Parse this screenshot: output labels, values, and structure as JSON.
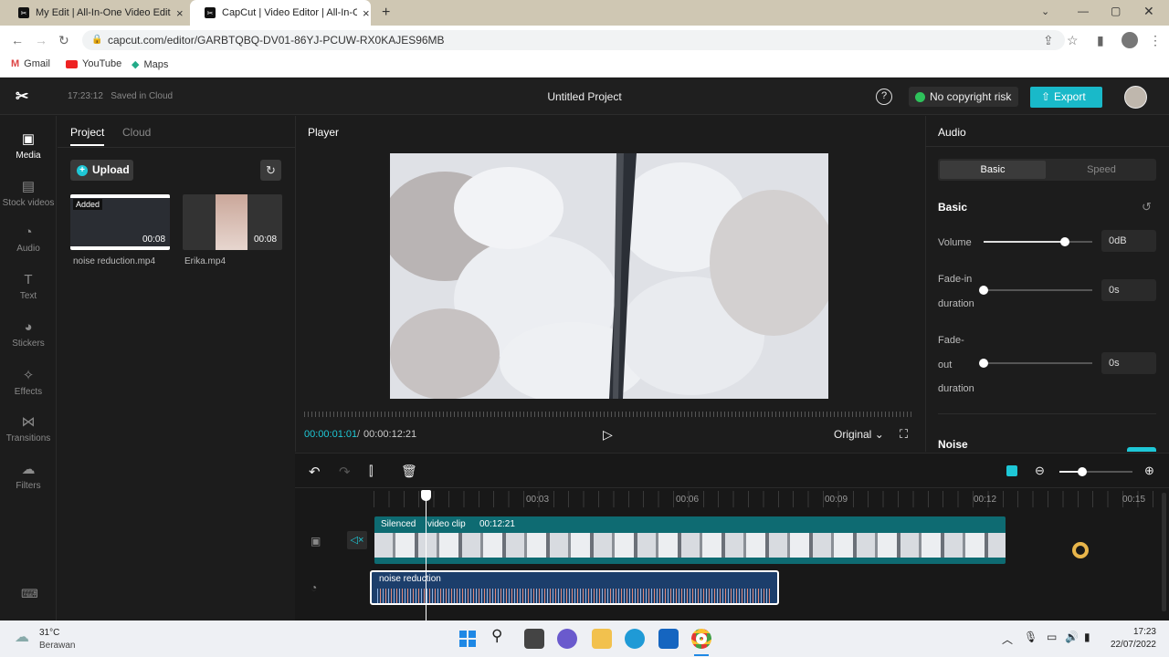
{
  "browser": {
    "tabs": [
      {
        "title": "My Edit | All-In-One Video Editing",
        "close": "×"
      },
      {
        "title": "CapCut | Video Editor | All-In-One",
        "close": "×"
      }
    ],
    "new_tab": "+",
    "url": "capcut.com/editor/GARBTQBQ-DV01-86YJ-PCUW-RX0KAJES96MB",
    "bookmarks": [
      "Gmail",
      "YouTube",
      "Maps"
    ]
  },
  "header": {
    "saved_status": "17:23:12   Saved in Cloud",
    "project_title": "Untitled Project",
    "help": "?",
    "copyright": "No copyright risk",
    "export": "Export"
  },
  "rail": [
    "Media",
    "Stock videos",
    "Audio",
    "Text",
    "Stickers",
    "Effects",
    "Transitions",
    "Filters"
  ],
  "media": {
    "tabs": [
      "Project",
      "Cloud"
    ],
    "upload": "Upload",
    "items": [
      {
        "name": "noise reduction.mp4",
        "duration": "00:08",
        "badge": "Added"
      },
      {
        "name": "Erika.mp4",
        "duration": "00:08"
      }
    ]
  },
  "player": {
    "title": "Player",
    "current_time": "00:00:01:01",
    "separator": "/",
    "total_time": "00:00:12:21",
    "ratio": "Original"
  },
  "props": {
    "title": "Audio",
    "tabs": [
      "Basic",
      "Speed"
    ],
    "section": "Basic",
    "volume_label": "Volume",
    "volume_value": "0dB",
    "volume_level": 0.75,
    "fadein_label1": "Fade-in",
    "fadein_label2": "duration",
    "fadein_value": "0s",
    "fadeout_label1": "Fade-",
    "fadeout_label2": "out",
    "fadeout_label3": "duration",
    "fadeout_value": "0s",
    "noise_label": "Noise"
  },
  "timeline": {
    "ticks": [
      "00:03",
      "00:06",
      "00:09",
      "00:12",
      "00:15"
    ],
    "video_tag": "Silenced",
    "video_name": "video clip",
    "video_duration": "00:12:21",
    "audio_name": "noise reduction"
  },
  "taskbar": {
    "temp": "31°C",
    "weather": "Berawan",
    "time": "17:23",
    "date": "22/07/2022"
  },
  "colors": {
    "accent": "#1ec7d6",
    "export_bg": "#19b9c9",
    "video_track": "#0e6b72",
    "audio_track": "#1c3e6b"
  }
}
